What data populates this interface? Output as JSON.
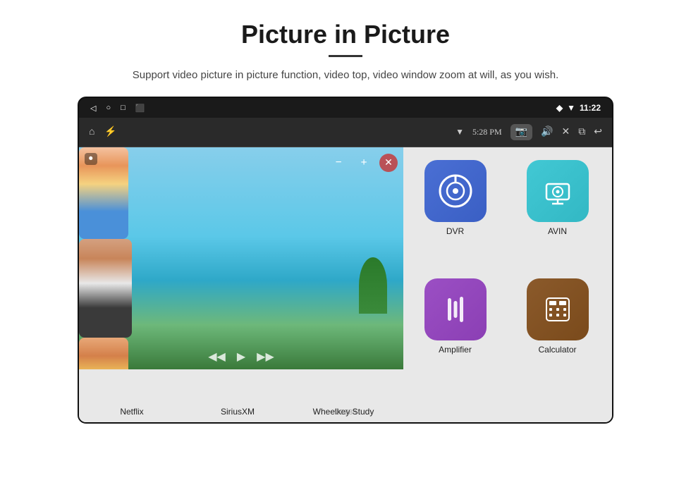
{
  "header": {
    "title": "Picture in Picture",
    "subtitle": "Support video picture in picture function, video top, video window zoom at will, as you wish."
  },
  "statusBar": {
    "leftIcons": [
      "back-arrow",
      "circle",
      "square",
      "bookmark"
    ],
    "rightIcons": [
      "location-pin",
      "wifi"
    ],
    "time": "11:22"
  },
  "navBar": {
    "leftIcons": [
      "home",
      "usb"
    ],
    "centerText": "5:28 PM",
    "rightIcons": [
      "camera",
      "volume",
      "close-box",
      "pip-box",
      "back-arrow"
    ]
  },
  "partialApps": [
    {
      "label": "",
      "color": "#5cb85c"
    },
    {
      "label": "",
      "color": "#e84c8c"
    },
    {
      "label": "",
      "color": "#9c4fc4"
    }
  ],
  "bottomApps": [
    {
      "label": "Netflix",
      "color": "#e50914"
    },
    {
      "label": "SiriusXM",
      "color": "#0a74c4"
    },
    {
      "label": "Wheelkey Study",
      "color": "#4a90d9"
    }
  ],
  "appGrid": [
    {
      "id": "dvr",
      "label": "DVR",
      "colorClass": "icon-dvr",
      "icon": "dvr"
    },
    {
      "id": "avin",
      "label": "AVIN",
      "colorClass": "icon-avin",
      "icon": "avin"
    },
    {
      "id": "amplifier",
      "label": "Amplifier",
      "colorClass": "icon-amplifier",
      "icon": "amplifier"
    },
    {
      "id": "calculator",
      "label": "Calculator",
      "colorClass": "icon-calculator",
      "icon": "calculator"
    }
  ],
  "pip": {
    "minusLabel": "−",
    "plusLabel": "+",
    "closeLabel": "✕",
    "rewindLabel": "◀◀",
    "playLabel": "▶",
    "forwardLabel": "▶▶"
  },
  "watermark": "VCZ88"
}
